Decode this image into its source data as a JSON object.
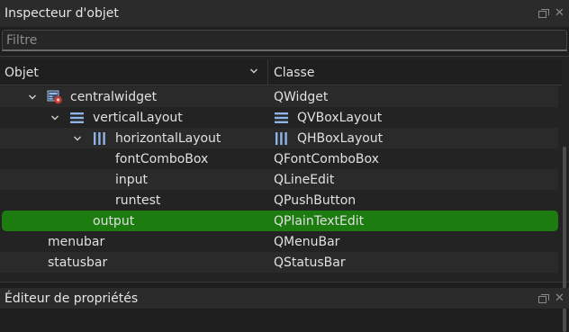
{
  "object_inspector": {
    "title": "Inspecteur d'objet",
    "filter_placeholder": "Filtre",
    "columns": {
      "object": "Objet",
      "class": "Classe"
    },
    "rows": [
      {
        "object": "centralwidget",
        "class": "QWidget",
        "expanded": true,
        "icon": "widget-icon"
      },
      {
        "object": "verticalLayout",
        "class": "QVBoxLayout",
        "expanded": true,
        "icon": "vbox-layout-icon"
      },
      {
        "object": "horizontalLayout",
        "class": "QHBoxLayout",
        "expanded": true,
        "icon": "hbox-layout-icon"
      },
      {
        "object": "fontComboBox",
        "class": "QFontComboBox"
      },
      {
        "object": "input",
        "class": "QLineEdit"
      },
      {
        "object": "runtest",
        "class": "QPushButton"
      },
      {
        "object": "output",
        "class": "QPlainTextEdit",
        "selected": true
      },
      {
        "object": "menubar",
        "class": "QMenuBar"
      },
      {
        "object": "statusbar",
        "class": "QStatusBar"
      }
    ]
  },
  "property_editor": {
    "title": "Éditeur de propriétés"
  },
  "colors": {
    "selection": "#1c7c10",
    "layout_icon": "#8fb3e6"
  }
}
